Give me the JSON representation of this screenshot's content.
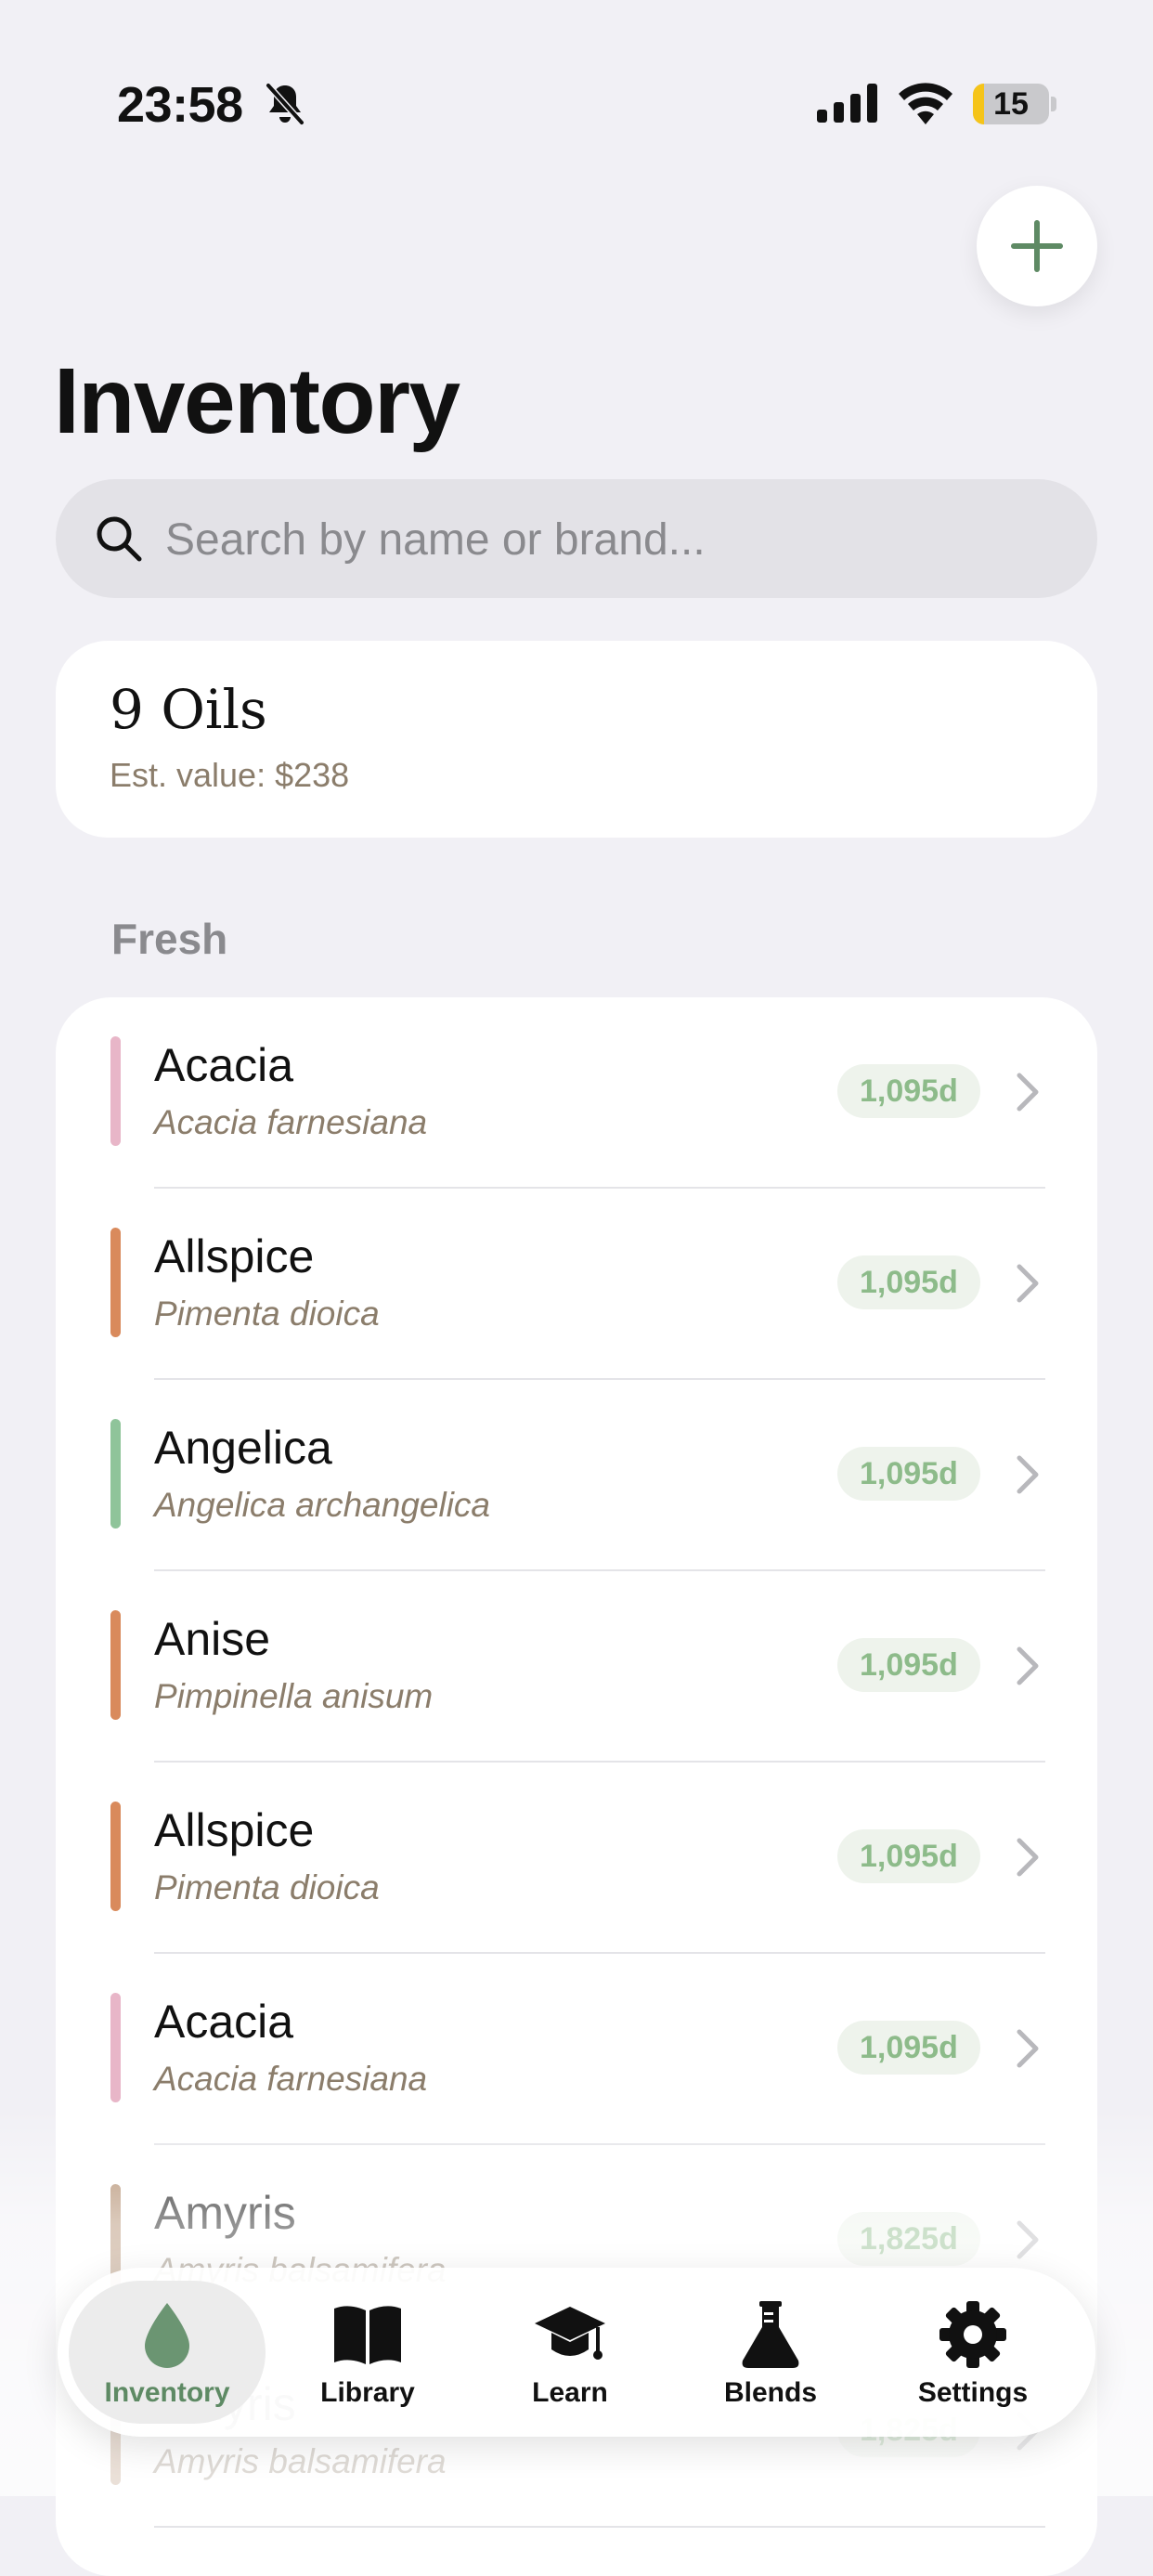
{
  "status_bar": {
    "time": "23:58",
    "battery": "15",
    "battery_level": 0.15
  },
  "page": {
    "title": "Inventory"
  },
  "search": {
    "placeholder": "Search by name or brand..."
  },
  "summary": {
    "count": "9 Oils",
    "value": "Est. value: $238"
  },
  "section": {
    "title": "Fresh"
  },
  "rows": [
    {
      "name": "Acacia",
      "latin": "Acacia farnesiana",
      "badge": "1,095d",
      "color": "#e8b6c8"
    },
    {
      "name": "Allspice",
      "latin": "Pimenta dioica",
      "badge": "1,095d",
      "color": "#d98a5c"
    },
    {
      "name": "Angelica",
      "latin": "Angelica archangelica",
      "badge": "1,095d",
      "color": "#8fc49a"
    },
    {
      "name": "Anise",
      "latin": "Pimpinella anisum",
      "badge": "1,095d",
      "color": "#d98a5c"
    },
    {
      "name": "Allspice",
      "latin": "Pimenta dioica",
      "badge": "1,095d",
      "color": "#d98a5c"
    },
    {
      "name": "Acacia",
      "latin": "Acacia farnesiana",
      "badge": "1,095d",
      "color": "#e8b6c8"
    },
    {
      "name": "Amyris",
      "latin": "Amyris balsamifera",
      "badge": "1,825d",
      "color": "#b08a6a"
    },
    {
      "name": "Amyris",
      "latin": "Amyris balsamifera",
      "badge": "1,825d",
      "color": "#b08a6a"
    }
  ],
  "tabs": [
    {
      "label": "Inventory",
      "icon": "drop-icon",
      "active": true
    },
    {
      "label": "Library",
      "icon": "book-icon"
    },
    {
      "label": "Learn",
      "icon": "graduation-cap-icon"
    },
    {
      "label": "Blends",
      "icon": "flask-icon"
    },
    {
      "label": "Settings",
      "icon": "gear-icon"
    }
  ],
  "colors": {
    "accent": "#5e8a64",
    "badge_text": "#8dbb8a",
    "badge_bg": "#eef3ec",
    "latin_text": "#8b7d6b"
  }
}
